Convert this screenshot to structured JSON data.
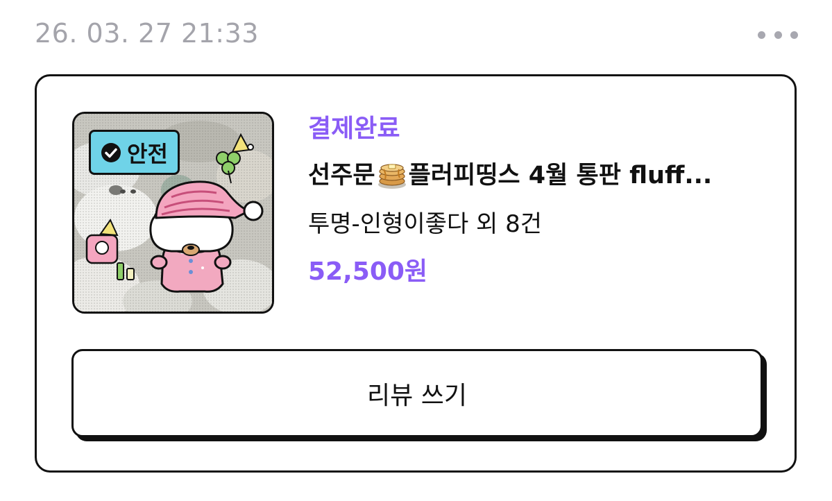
{
  "order": {
    "datetime": "26. 03. 27 21:33",
    "more_icon": "more-horizontal-icon",
    "status": "결제완료",
    "badge": {
      "label": "안전",
      "icon": "check-circle-icon",
      "color": "#6fd3e8"
    },
    "title_prefix": "선주문",
    "title_emoji": "pancake-icon",
    "title_suffix": "플러피띵스 4월 통판 fluff...",
    "options": "투명-인형이좋다 외 8건",
    "price": "52,500원",
    "review_button": "리뷰 쓰기"
  },
  "colors": {
    "accent": "#8a5cf6",
    "muted": "#a4a4ab",
    "border": "#111111"
  }
}
